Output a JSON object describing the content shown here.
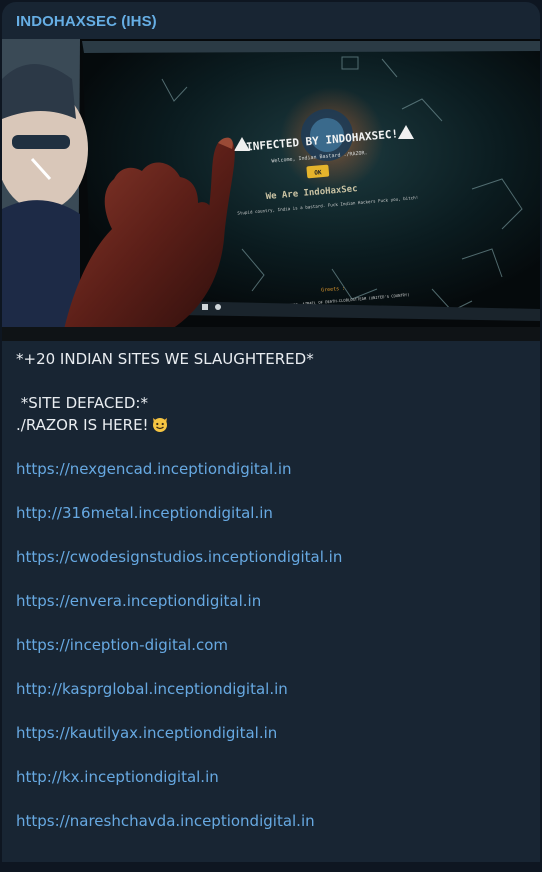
{
  "message": {
    "sender": "INDOHAXSEC (IHS)",
    "photo": {
      "screen_title": "INFECTED BY INDOHAXSEC!",
      "screen_subtitle": "Welcome, Indian Bastard ./RAZOR.",
      "screen_button": "OK",
      "screen_heading": "We Are IndoHaxSec",
      "screen_text": "Stupid country, India is a bastard. Fuck Indian Hackers Fuck you, bitch!",
      "screen_greets_label": "Greets :",
      "screen_footer": "-INDOHAXSEC -AZRAEL OF DEATH-CLOBLOSTTEAM (UNITED'S COUNTRY)"
    },
    "headline": "*+20 INDIAN SITES WE SLAUGHTERED*",
    "subhead": " *SITE DEFACED:*",
    "author_line": "./RAZOR IS HERE!",
    "emoji": "smiling-cat-icon",
    "links": [
      "https://nexgencad.inceptiondigital.in",
      "http://316metal.inceptiondigital.in",
      "https://cwodesignstudios.inceptiondigital.in",
      "https://envera.inceptiondigital.in",
      "https://inception-digital.com",
      "http://kasprglobal.inceptiondigital.in",
      "https://kautilyax.inceptiondigital.in",
      "http://kx.inceptiondigital.in",
      "https://nareshchavda.inceptiondigital.in"
    ]
  },
  "colors": {
    "background": "#0e1621",
    "bubble": "#182533",
    "sender": "#66aee4",
    "text": "#e9edf1",
    "link": "#67a9e2"
  }
}
